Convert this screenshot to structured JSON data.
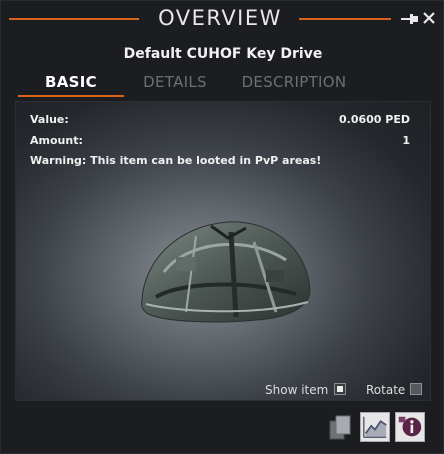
{
  "window": {
    "title": "OVERVIEW"
  },
  "item": {
    "name": "Default CUHOF Key Drive"
  },
  "tabs": [
    {
      "label": "BASIC",
      "active": true
    },
    {
      "label": "DETAILS",
      "active": false
    },
    {
      "label": "DESCRIPTION",
      "active": false
    }
  ],
  "basic": {
    "value_label": "Value:",
    "value": "0.0600 PED",
    "amount_label": "Amount:",
    "amount": "1",
    "warning": "Warning: This item can be looted in PvP areas!"
  },
  "options": {
    "show_item_label": "Show item",
    "show_item_checked": true,
    "rotate_label": "Rotate",
    "rotate_checked": false
  },
  "icons": {
    "pin": "pin-icon",
    "close": "close-icon",
    "copy": "copy-icon",
    "chart": "chart-icon",
    "info": "info-icon"
  },
  "colors": {
    "accent": "#d8641c",
    "window_bg": "#1b1d21",
    "text": "#f0f0f0",
    "inactive_tab": "#6c6f75"
  }
}
